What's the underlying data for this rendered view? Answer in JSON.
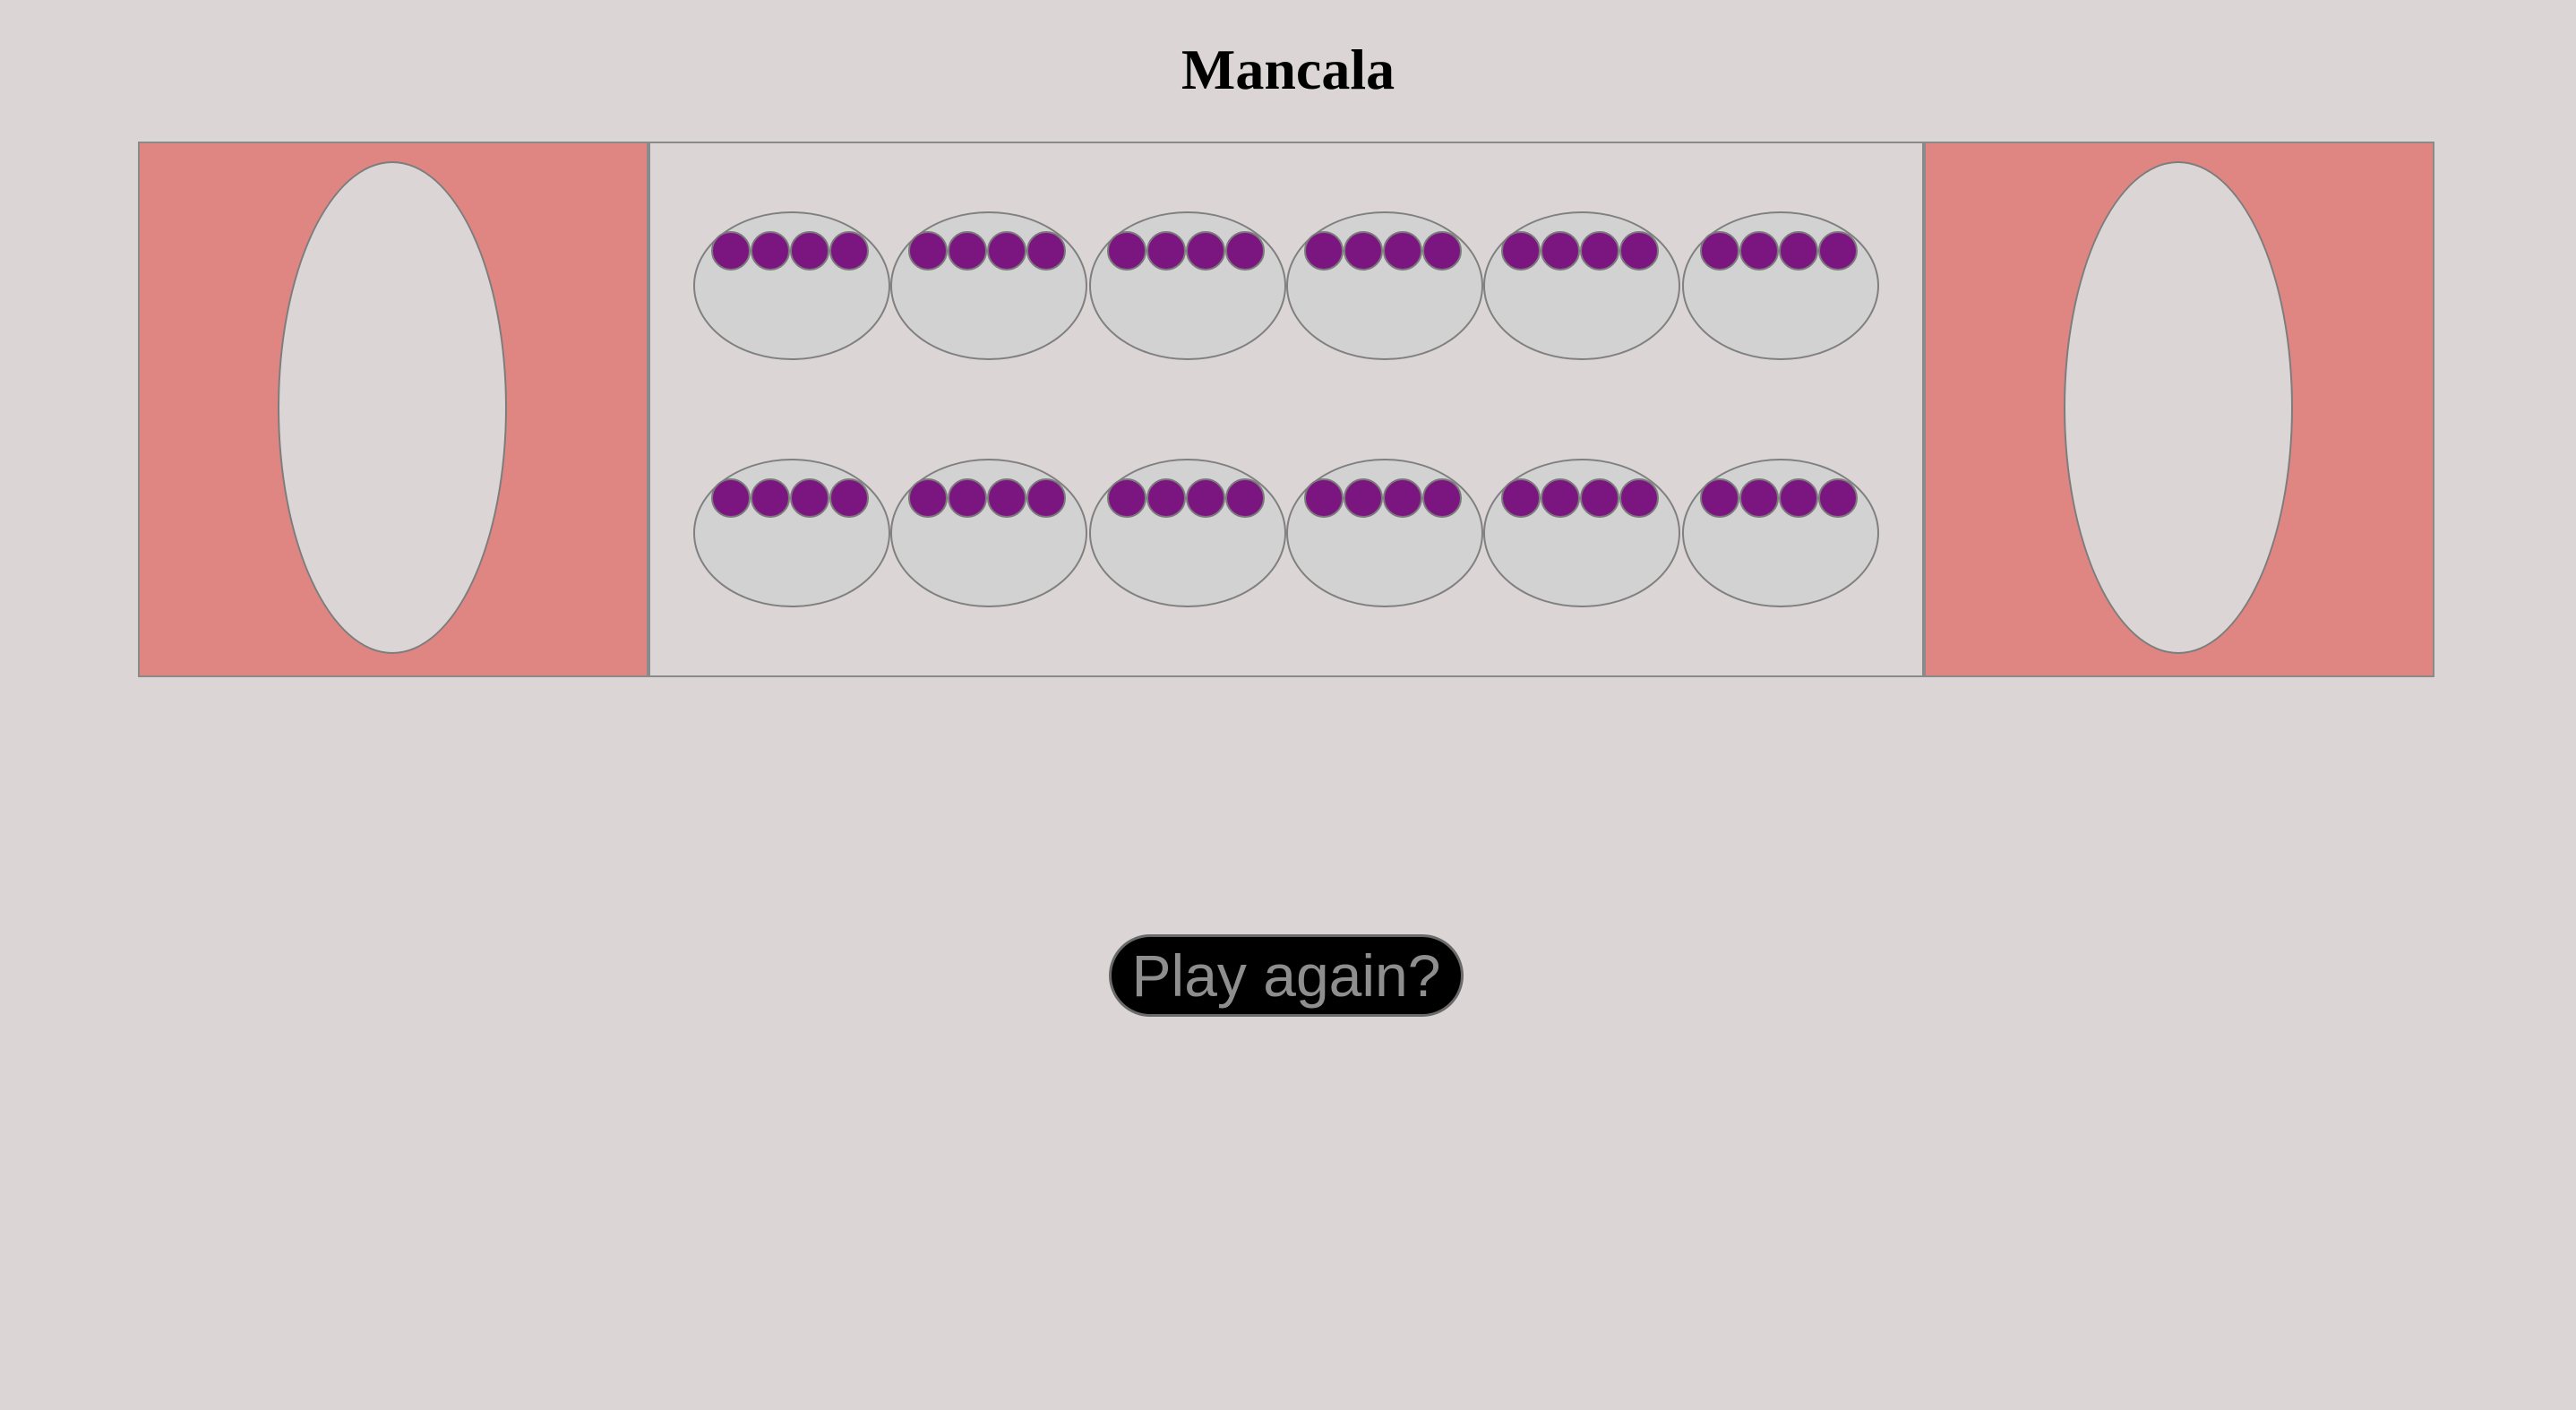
{
  "title": "Mancala",
  "colors": {
    "background": "#dbd5d6",
    "store_fill": "#e08682",
    "pit_fill": "#d2d2d2",
    "seed": "#7b1680",
    "button_bg": "#000000",
    "button_text": "#8e8e8e"
  },
  "board": {
    "stores": [
      {
        "side": "left",
        "seeds": 0
      },
      {
        "side": "right",
        "seeds": 0
      }
    ],
    "rows": [
      {
        "pits": [
          4,
          4,
          4,
          4,
          4,
          4
        ]
      },
      {
        "pits": [
          4,
          4,
          4,
          4,
          4,
          4
        ]
      }
    ]
  },
  "play_again_label": "Play again?"
}
